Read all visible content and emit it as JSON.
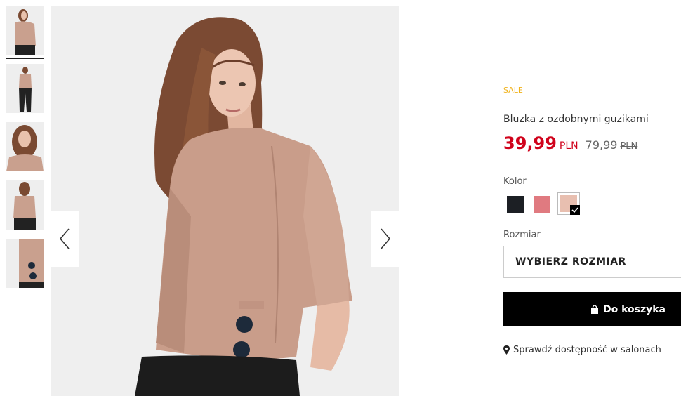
{
  "thumbnails": [
    {
      "name": "thumb-front-closeup",
      "selected": true
    },
    {
      "name": "thumb-full-body",
      "selected": false
    },
    {
      "name": "thumb-portrait",
      "selected": false
    },
    {
      "name": "thumb-back",
      "selected": false
    },
    {
      "name": "thumb-button-detail",
      "selected": false
    }
  ],
  "navigation": {
    "prev_icon": "chevron-left-icon",
    "next_icon": "chevron-right-icon"
  },
  "product": {
    "badge": "SALE",
    "title": "Bluzka z ozdobnymi guzikami",
    "price_current": "39,99",
    "currency": "PLN",
    "price_old": "79,99",
    "currency_old": "PLN"
  },
  "colors": {
    "label": "Kolor",
    "options": [
      {
        "name": "black",
        "hex": "#1c1f24",
        "selected": false
      },
      {
        "name": "pink",
        "hex": "#e07a80",
        "selected": false
      },
      {
        "name": "beige",
        "hex": "#e8bfb0",
        "selected": true
      }
    ]
  },
  "size": {
    "label": "Rozmiar",
    "placeholder": "WYBIERZ ROZMIAR"
  },
  "cart": {
    "label": "Do koszyka",
    "icon": "shopping-bag-icon"
  },
  "availability": {
    "label": "Sprawdź dostępność w salonach",
    "icon": "location-pin-icon"
  },
  "theme": {
    "sale_color": "#f0b21a",
    "price_color": "#d0021b",
    "button_color": "#000000"
  }
}
